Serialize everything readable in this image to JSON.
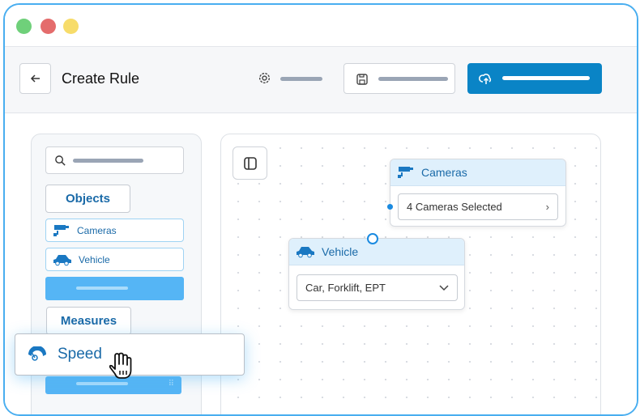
{
  "window": {
    "controls": [
      "close",
      "minimize",
      "maximize"
    ]
  },
  "toolbar": {
    "title": "Create Rule",
    "back_icon": "arrow-left",
    "settings_icon": "gear",
    "save_icon": "floppy-disk",
    "publish_icon": "cloud-upload"
  },
  "sidebar": {
    "sections": [
      {
        "label": "Objects",
        "items": [
          {
            "label": "Cameras",
            "icon": "camera"
          },
          {
            "label": "Vehicle",
            "icon": "car"
          }
        ]
      },
      {
        "label": "Measures"
      }
    ]
  },
  "drag": {
    "label": "Speed",
    "icon": "speedometer"
  },
  "nodes": {
    "cameras": {
      "title": "Cameras",
      "value": "4 Cameras Selected"
    },
    "vehicle": {
      "title": "Vehicle",
      "value": "Car, Forklift, EPT"
    }
  },
  "colors": {
    "accent": "#0a84c6",
    "light_accent": "#55b5f5",
    "text_blue": "#1a6aa8"
  }
}
